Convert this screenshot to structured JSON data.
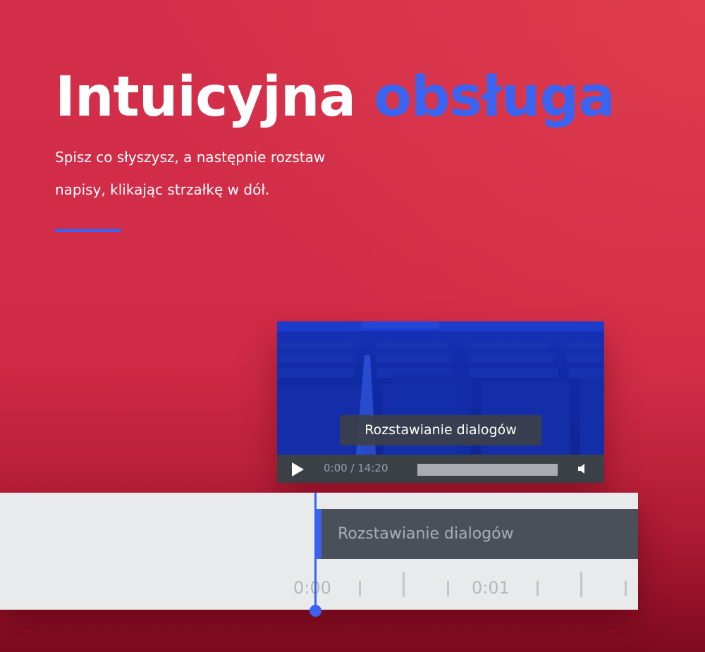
{
  "hero": {
    "title_main": "Intuicyjna",
    "title_accent": "obsługa",
    "subtitle": "Spisz co słyszysz, a następnie rozstaw napisy, klikając strzałkę w dół."
  },
  "player": {
    "subtitle_text": "Rozstawianie dialogów",
    "time": "0:00 / 14:20",
    "play_icon": "play-icon",
    "volume_icon": "volume-icon"
  },
  "timeline": {
    "caption_text": "Rozstawianie dialogów",
    "ruler_labels": [
      "0:00",
      "0:01"
    ]
  },
  "colors": {
    "background": "#d42f4a",
    "accent": "#3a64f0",
    "controls": "#3c4047",
    "timeline_bg": "#e9eaeb",
    "caption_bg": "#4a5059"
  }
}
